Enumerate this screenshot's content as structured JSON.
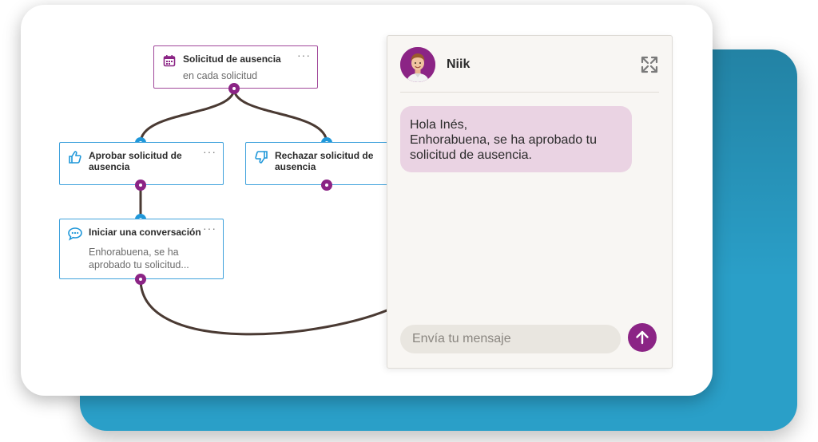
{
  "workflow": {
    "nodes": [
      {
        "title": "Solicitud de ausencia",
        "subtitle": "en cada solicitud",
        "icon": "calendar-icon"
      },
      {
        "title_line1": "Aprobar solicitud de",
        "title_line2": "ausencia",
        "icon": "thumbs-up-icon"
      },
      {
        "title_line1": "Rechazar solicitud de",
        "title_line2": "ausencia",
        "icon": "thumbs-down-icon"
      },
      {
        "title": "Iniciar una conversación",
        "subtitle_line1": "Enhorabuena, se ha",
        "subtitle_line2": "aprobado tu solicitud...",
        "icon": "chat-bubble-icon"
      }
    ],
    "menu_glyph": "···"
  },
  "chat": {
    "name": "Niik",
    "message_lines": [
      "Hola Inés,",
      "Enhorabuena, se ha aprobado tu",
      "solicitud de ausencia."
    ],
    "input_placeholder": "Envía tu mensaje",
    "input_value": ""
  },
  "colors": {
    "purple": "#8b2485",
    "blue": "#1f97d9",
    "bubble": "#ead3e3",
    "backdrop": "#2a9fc8"
  }
}
